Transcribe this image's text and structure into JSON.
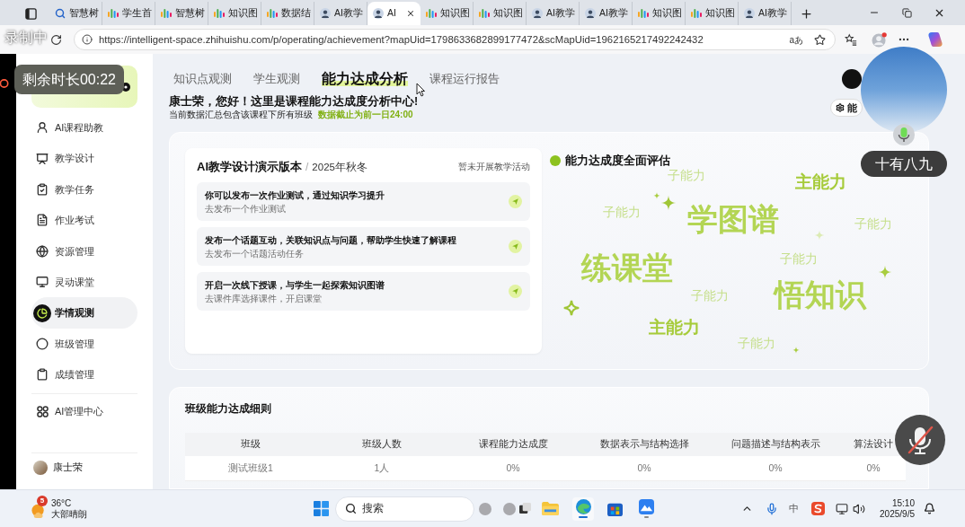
{
  "browser": {
    "tabs": [
      {
        "label": "智慧树",
        "kind": "search",
        "selected": false
      },
      {
        "label": "学生首",
        "kind": "site",
        "selected": false
      },
      {
        "label": "智慧树",
        "kind": "site",
        "selected": false
      },
      {
        "label": "知识图",
        "kind": "site",
        "selected": false
      },
      {
        "label": "数据结",
        "kind": "site",
        "selected": false
      },
      {
        "label": "AI教学",
        "kind": "person",
        "selected": false
      },
      {
        "label": "AI",
        "kind": "person",
        "selected": true
      },
      {
        "label": "知识图",
        "kind": "site",
        "selected": false
      },
      {
        "label": "知识图",
        "kind": "site",
        "selected": false
      },
      {
        "label": "AI教学",
        "kind": "person",
        "selected": false
      },
      {
        "label": "AI教学",
        "kind": "person",
        "selected": false
      },
      {
        "label": "知识图",
        "kind": "site",
        "selected": false
      },
      {
        "label": "知识图",
        "kind": "site",
        "selected": false
      },
      {
        "label": "AI教学",
        "kind": "person",
        "selected": false
      }
    ],
    "url": "https://intelligent-space.zhihuishu.com/p/operating/achievement?mapUid=1798633682899177472&scMapUid=1962165217492242432",
    "read_aloud": "aあ"
  },
  "recording": {
    "status": "录制中",
    "remaining": "剩余时长00:22"
  },
  "sidebar": {
    "items": [
      {
        "label": "AI课程助教",
        "selected": false
      },
      {
        "label": "教学设计",
        "selected": false
      },
      {
        "label": "教学任务",
        "selected": false
      },
      {
        "label": "作业考试",
        "selected": false
      },
      {
        "label": "资源管理",
        "selected": false
      },
      {
        "label": "灵动课堂",
        "selected": false
      },
      {
        "label": "学情观测",
        "selected": true
      },
      {
        "label": "班级管理",
        "selected": false
      },
      {
        "label": "成绩管理",
        "selected": false
      }
    ],
    "admin": "AI管理中心",
    "user": "康士荣"
  },
  "tabs": [
    {
      "label": "知识点观测",
      "selected": false
    },
    {
      "label": "学生观测",
      "selected": false
    },
    {
      "label": "能力达成分析",
      "selected": true
    },
    {
      "label": "课程运行报告",
      "selected": false
    }
  ],
  "header": {
    "greeting": "康士荣，您好！这里是课程能力达成度分析中心!",
    "note": "当前数据汇总包含该课程下所有班级",
    "cutoff": "数据截止为前一日24:00",
    "button": "能"
  },
  "camera": {
    "name": "十有八九"
  },
  "course_card": {
    "title": "AI教学设计演示版本",
    "separator": "/",
    "term": "2025年秋冬",
    "status": "暂未开展教学活动",
    "tasks": [
      {
        "title": "你可以发布一次作业测试，通过知识学习提升",
        "subtitle": "去发布一个作业测试"
      },
      {
        "title": "发布一个话题互动，关联知识点与问题，帮助学生快速了解课程",
        "subtitle": "去发布一个话题活动任务"
      },
      {
        "title": "开启一次线下授课，与学生一起探索知识图谱",
        "subtitle": "去课件库选择课件，开启课堂"
      }
    ]
  },
  "assessment": {
    "title": "能力达成度全面评估",
    "words": [
      {
        "text": "子能力",
        "kind": "sub"
      },
      {
        "text": "主能力",
        "kind": "main"
      },
      {
        "text": "子能力",
        "kind": "sub"
      },
      {
        "text": "学图谱",
        "kind": "key"
      },
      {
        "text": "子能力",
        "kind": "sub"
      },
      {
        "text": "子能力",
        "kind": "sub"
      },
      {
        "text": "练课堂",
        "kind": "key"
      },
      {
        "text": "子能力",
        "kind": "sub"
      },
      {
        "text": "悟知识",
        "kind": "key"
      },
      {
        "text": "主能力",
        "kind": "main"
      },
      {
        "text": "子能力",
        "kind": "sub"
      }
    ]
  },
  "class_table": {
    "title": "班级能力达成细则",
    "columns": [
      "班级",
      "班级人数",
      "课程能力达成度",
      "数据表示与结构选择",
      "问题描述与结构表示",
      "算法设计"
    ],
    "rows": [
      [
        "测试班级1",
        "1人",
        "0%",
        "0%",
        "0%",
        "0%"
      ]
    ]
  },
  "taskbar": {
    "badge": "5",
    "temperature": "36°C",
    "weather": "大部晴朗",
    "search_placeholder": "搜索",
    "ime": "中",
    "time": "15:10",
    "date": "2025/9/5"
  }
}
